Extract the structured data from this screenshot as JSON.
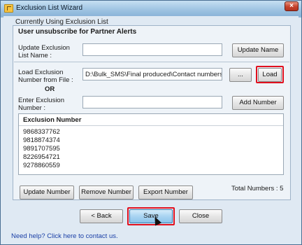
{
  "window": {
    "title": "Exclusion List Wizard",
    "close_label": "×"
  },
  "section_label": "Currently Using Exclusion List",
  "heading": "User unsubscribe for Partner Alerts",
  "update": {
    "label_line1": "Update Exclusion",
    "label_line2": "List Name :",
    "value": "",
    "button": "Update Name"
  },
  "load": {
    "label_line1": "Load Exclusion",
    "label_line2": "Number from File :",
    "value": "D:\\Bulk_SMS\\Final produced\\Contact numbers.t",
    "browse_button": "...",
    "load_button": "Load"
  },
  "or_text": "OR",
  "enter": {
    "label_line1": "Enter Exclusion",
    "label_line2": "Number :",
    "value": "",
    "button": "Add Number"
  },
  "list": {
    "header": "Exclusion Number",
    "rows": [
      "9868337762",
      "9818874374",
      "9891707595",
      "8226954721",
      "9278860559"
    ]
  },
  "actions": {
    "update_number": "Update Number",
    "remove_number": "Remove Number",
    "export_number": "Export Number",
    "total_label": "Total Numbers : 5"
  },
  "footer": {
    "back": "< Back",
    "save": "Save",
    "close": "Close",
    "help": "Need help? Click here to contact us."
  },
  "colors": {
    "highlight": "#e0101e",
    "link": "#1a3fa6"
  }
}
